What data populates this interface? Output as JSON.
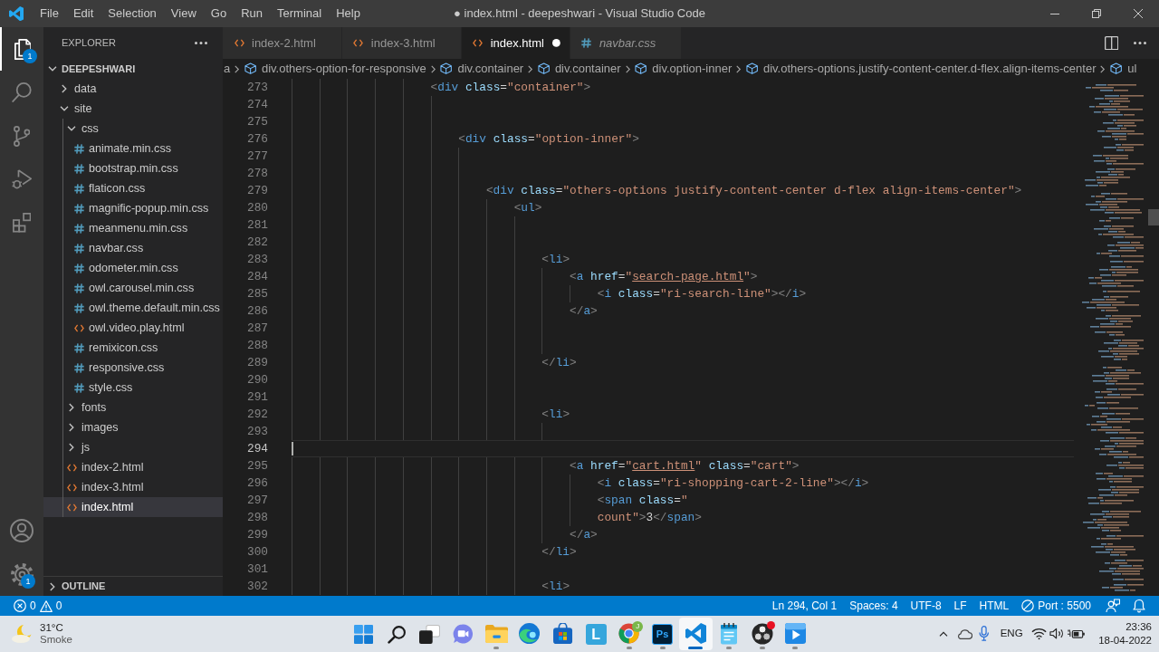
{
  "title_bar": {
    "menus": [
      "File",
      "Edit",
      "Selection",
      "View",
      "Go",
      "Run",
      "Terminal",
      "Help"
    ],
    "title": "● index.html - deepeshwari - Visual Studio Code"
  },
  "activity_bar": {
    "items": [
      {
        "kind": "explorer",
        "selected": true,
        "badge": "1"
      },
      {
        "kind": "search",
        "selected": false
      },
      {
        "kind": "source-control",
        "selected": false
      },
      {
        "kind": "run",
        "selected": false
      },
      {
        "kind": "extensions",
        "selected": false
      }
    ],
    "bottom": [
      {
        "kind": "account",
        "selected": false
      },
      {
        "kind": "settings",
        "selected": false,
        "badge": "1"
      }
    ]
  },
  "sidebar": {
    "title": "EXPLORER",
    "folder": {
      "name": "DEEPESHWARI",
      "expanded": true
    },
    "tree": [
      {
        "name": "data",
        "kind": "folder",
        "expanded": false,
        "selected": false
      },
      {
        "name": "site",
        "kind": "folder",
        "expanded": true,
        "selected": false,
        "children": [
          {
            "name": "css",
            "kind": "folder",
            "expanded": true,
            "selected": false,
            "children": [
              {
                "name": "animate.min.css",
                "kind": "css",
                "selected": false
              },
              {
                "name": "bootstrap.min.css",
                "kind": "css",
                "selected": false
              },
              {
                "name": "flaticon.css",
                "kind": "css",
                "selected": false
              },
              {
                "name": "magnific-popup.min.css",
                "kind": "css",
                "selected": false
              },
              {
                "name": "meanmenu.min.css",
                "kind": "css",
                "selected": false
              },
              {
                "name": "navbar.css",
                "kind": "css",
                "selected": false
              },
              {
                "name": "odometer.min.css",
                "kind": "css",
                "selected": false
              },
              {
                "name": "owl.carousel.min.css",
                "kind": "css",
                "selected": false
              },
              {
                "name": "owl.theme.default.min.css",
                "kind": "css",
                "selected": false
              },
              {
                "name": "owl.video.play.html",
                "kind": "html",
                "selected": false
              },
              {
                "name": "remixicon.css",
                "kind": "css",
                "selected": false
              },
              {
                "name": "responsive.css",
                "kind": "css",
                "selected": false
              },
              {
                "name": "style.css",
                "kind": "css",
                "selected": false
              }
            ]
          },
          {
            "name": "fonts",
            "kind": "folder",
            "expanded": false,
            "selected": false
          },
          {
            "name": "images",
            "kind": "folder",
            "expanded": false,
            "selected": false
          },
          {
            "name": "js",
            "kind": "folder",
            "expanded": false,
            "selected": false
          },
          {
            "name": "index-2.html",
            "kind": "html",
            "selected": false
          },
          {
            "name": "index-3.html",
            "kind": "html",
            "selected": false
          },
          {
            "name": "index.html",
            "kind": "html",
            "selected": true
          }
        ]
      }
    ],
    "outline": {
      "title": "OUTLINE",
      "expanded": false
    }
  },
  "editor": {
    "tabs": [
      {
        "label": "index-2.html",
        "kind": "html",
        "selected": false,
        "modified": false,
        "preview": false
      },
      {
        "label": "index-3.html",
        "kind": "html",
        "selected": false,
        "modified": false,
        "preview": false
      },
      {
        "label": "index.html",
        "kind": "html",
        "selected": true,
        "modified": true,
        "preview": false
      },
      {
        "label": "navbar.css",
        "kind": "css",
        "selected": false,
        "modified": false,
        "preview": true
      }
    ],
    "breadcrumb": [
      {
        "label": "a",
        "kind": "text"
      },
      {
        "label": "div.others-option-for-responsive",
        "kind": "element"
      },
      {
        "label": "div.container",
        "kind": "element"
      },
      {
        "label": "div.container",
        "kind": "element"
      },
      {
        "label": "div.option-inner",
        "kind": "element"
      },
      {
        "label": "div.others-options.justify-content-center.d-flex.align-items-center",
        "kind": "element"
      },
      {
        "label": "ul",
        "kind": "element"
      }
    ],
    "lines": [
      {
        "number": "273",
        "current": false,
        "tokens": [
          {
            "kind": "punct",
            "text": "<"
          },
          {
            "kind": "tag",
            "text": "div"
          },
          {
            "kind": "attr",
            "text": " class"
          },
          {
            "kind": "op",
            "text": "="
          },
          {
            "kind": "string",
            "text": "\"container\""
          },
          {
            "kind": "punct",
            "text": ">"
          }
        ],
        "children": [
          {
            "number": "274",
            "current": false
          },
          {
            "number": "275",
            "current": false
          },
          {
            "number": "276",
            "current": false,
            "tokens": [
              {
                "kind": "punct",
                "text": "<"
              },
              {
                "kind": "tag",
                "text": "div"
              },
              {
                "kind": "attr",
                "text": " class"
              },
              {
                "kind": "op",
                "text": "="
              },
              {
                "kind": "string",
                "text": "\"option-inner\""
              },
              {
                "kind": "punct",
                "text": ">"
              }
            ],
            "children": [
              {
                "number": "277",
                "current": false
              },
              {
                "number": "278",
                "current": false
              },
              {
                "number": "279",
                "current": false,
                "tokens": [
                  {
                    "kind": "punct",
                    "text": "<"
                  },
                  {
                    "kind": "tag",
                    "text": "div"
                  },
                  {
                    "kind": "attr",
                    "text": " class"
                  },
                  {
                    "kind": "op",
                    "text": "="
                  },
                  {
                    "kind": "string",
                    "text": "\"others-options justify-content-center d-flex align-items-center\""
                  },
                  {
                    "kind": "punct",
                    "text": ">"
                  }
                ],
                "children": [
                  {
                    "number": "280",
                    "current": false,
                    "tokens": [
                      {
                        "kind": "punct",
                        "text": "<"
                      },
                      {
                        "kind": "tag",
                        "text": "ul"
                      },
                      {
                        "kind": "punct",
                        "text": ">"
                      }
                    ],
                    "children": [
                      {
                        "number": "281",
                        "current": false
                      },
                      {
                        "number": "282",
                        "current": false
                      },
                      {
                        "number": "283",
                        "current": false,
                        "tokens": [
                          {
                            "kind": "punct",
                            "text": "<"
                          },
                          {
                            "kind": "tag",
                            "text": "li"
                          },
                          {
                            "kind": "punct",
                            "text": ">"
                          }
                        ],
                        "children": [
                          {
                            "number": "284",
                            "current": false,
                            "tokens": [
                              {
                                "kind": "punct",
                                "text": "<"
                              },
                              {
                                "kind": "tag",
                                "text": "a"
                              },
                              {
                                "kind": "attr",
                                "text": " href"
                              },
                              {
                                "kind": "op",
                                "text": "="
                              },
                              {
                                "kind": "string",
                                "text": "\""
                              },
                              {
                                "kind": "link",
                                "text": "search-page.html"
                              },
                              {
                                "kind": "string",
                                "text": "\""
                              },
                              {
                                "kind": "punct",
                                "text": ">"
                              }
                            ],
                            "children": [
                              {
                                "number": "285",
                                "current": false,
                                "tokens": [
                                  {
                                    "kind": "punct",
                                    "text": "<"
                                  },
                                  {
                                    "kind": "tag",
                                    "text": "i"
                                  },
                                  {
                                    "kind": "attr",
                                    "text": " class"
                                  },
                                  {
                                    "kind": "op",
                                    "text": "="
                                  },
                                  {
                                    "kind": "string",
                                    "text": "\"ri-search-line\""
                                  },
                                  {
                                    "kind": "punct",
                                    "text": "></"
                                  },
                                  {
                                    "kind": "tag",
                                    "text": "i"
                                  },
                                  {
                                    "kind": "punct",
                                    "text": ">"
                                  }
                                ]
                              }
                            ]
                          },
                          {
                            "number": "286",
                            "current": false,
                            "tokens": [
                              {
                                "kind": "punct",
                                "text": "</"
                              },
                              {
                                "kind": "tag",
                                "text": "a"
                              },
                              {
                                "kind": "punct",
                                "text": ">"
                              }
                            ]
                          },
                          {
                            "number": "287",
                            "current": false
                          },
                          {
                            "number": "288",
                            "current": false
                          }
                        ]
                      },
                      {
                        "number": "289",
                        "current": false,
                        "tokens": [
                          {
                            "kind": "punct",
                            "text": "</"
                          },
                          {
                            "kind": "tag",
                            "text": "li"
                          },
                          {
                            "kind": "punct",
                            "text": ">"
                          }
                        ]
                      },
                      {
                        "number": "290",
                        "current": false
                      },
                      {
                        "number": "291",
                        "current": false
                      },
                      {
                        "number": "292",
                        "current": false,
                        "tokens": [
                          {
                            "kind": "punct",
                            "text": "<"
                          },
                          {
                            "kind": "tag",
                            "text": "li"
                          },
                          {
                            "kind": "punct",
                            "text": ">"
                          }
                        ],
                        "children": [
                          {
                            "number": "293",
                            "current": false
                          },
                          {
                            "number": "294",
                            "current": true
                          },
                          {
                            "number": "295",
                            "current": false,
                            "tokens": [
                              {
                                "kind": "punct",
                                "text": "<"
                              },
                              {
                                "kind": "tag",
                                "text": "a"
                              },
                              {
                                "kind": "attr",
                                "text": " href"
                              },
                              {
                                "kind": "op",
                                "text": "="
                              },
                              {
                                "kind": "string",
                                "text": "\""
                              },
                              {
                                "kind": "link",
                                "text": "cart.html"
                              },
                              {
                                "kind": "string",
                                "text": "\""
                              },
                              {
                                "kind": "attr",
                                "text": " class"
                              },
                              {
                                "kind": "op",
                                "text": "="
                              },
                              {
                                "kind": "string",
                                "text": "\"cart\""
                              },
                              {
                                "kind": "punct",
                                "text": ">"
                              }
                            ],
                            "children": [
                              {
                                "number": "296",
                                "current": false,
                                "tokens": [
                                  {
                                    "kind": "punct",
                                    "text": "<"
                                  },
                                  {
                                    "kind": "tag",
                                    "text": "i"
                                  },
                                  {
                                    "kind": "attr",
                                    "text": " class"
                                  },
                                  {
                                    "kind": "op",
                                    "text": "="
                                  },
                                  {
                                    "kind": "string",
                                    "text": "\"ri-shopping-cart-2-line\""
                                  },
                                  {
                                    "kind": "punct",
                                    "text": "></"
                                  },
                                  {
                                    "kind": "tag",
                                    "text": "i"
                                  },
                                  {
                                    "kind": "punct",
                                    "text": ">"
                                  }
                                ]
                              },
                              {
                                "number": "297",
                                "current": false,
                                "tokens": [
                                  {
                                    "kind": "punct",
                                    "text": "<"
                                  },
                                  {
                                    "kind": "tag",
                                    "text": "span"
                                  },
                                  {
                                    "kind": "attr",
                                    "text": " class"
                                  },
                                  {
                                    "kind": "op",
                                    "text": "="
                                  },
                                  {
                                    "kind": "string",
                                    "text": "\""
                                  }
                                ]
                              },
                              {
                                "number": "298",
                                "current": false,
                                "tokens": [
                                  {
                                    "kind": "string",
                                    "text": "count\""
                                  },
                                  {
                                    "kind": "punct",
                                    "text": ">"
                                  },
                                  {
                                    "kind": "text",
                                    "text": "3"
                                  },
                                  {
                                    "kind": "punct",
                                    "text": "</"
                                  },
                                  {
                                    "kind": "tag",
                                    "text": "span"
                                  },
                                  {
                                    "kind": "punct",
                                    "text": ">"
                                  }
                                ]
                              }
                            ]
                          },
                          {
                            "number": "299",
                            "current": false,
                            "tokens": [
                              {
                                "kind": "punct",
                                "text": "</"
                              },
                              {
                                "kind": "tag",
                                "text": "a"
                              },
                              {
                                "kind": "punct",
                                "text": ">"
                              }
                            ]
                          }
                        ]
                      },
                      {
                        "number": "300",
                        "current": false,
                        "tokens": [
                          {
                            "kind": "punct",
                            "text": "</"
                          },
                          {
                            "kind": "tag",
                            "text": "li"
                          },
                          {
                            "kind": "punct",
                            "text": ">"
                          }
                        ]
                      },
                      {
                        "number": "301",
                        "current": false
                      },
                      {
                        "number": "302",
                        "current": false,
                        "tokens": [
                          {
                            "kind": "punct",
                            "text": "<"
                          },
                          {
                            "kind": "tag",
                            "text": "li"
                          },
                          {
                            "kind": "punct",
                            "text": ">"
                          }
                        ]
                      }
                    ]
                  }
                ]
              }
            ]
          }
        ]
      }
    ]
  },
  "status_bar": {
    "problems": {
      "errors": "0",
      "warnings": "0"
    },
    "items": [
      "Ln 294, Col 1",
      "Spaces: 4",
      "UTF-8",
      "LF",
      "HTML"
    ],
    "port": "Port : 5500"
  },
  "taskbar": {
    "weather": {
      "temperature": "31°C",
      "condition": "Smoke"
    },
    "apps": [
      {
        "kind": "start",
        "running": false,
        "selected": false,
        "alert": false
      },
      {
        "kind": "search",
        "running": false,
        "selected": false,
        "alert": false
      },
      {
        "kind": "taskview",
        "running": false,
        "selected": false,
        "alert": false
      },
      {
        "kind": "chat",
        "running": false,
        "selected": false,
        "alert": false
      },
      {
        "kind": "folder",
        "running": true,
        "selected": false,
        "alert": false
      },
      {
        "kind": "edge",
        "running": false,
        "selected": false,
        "alert": false
      },
      {
        "kind": "store",
        "running": false,
        "selected": false,
        "alert": false
      },
      {
        "kind": "letter",
        "label": "L",
        "running": false,
        "selected": false,
        "alert": false
      },
      {
        "kind": "chrome",
        "badge": "J",
        "running": true,
        "selected": false,
        "alert": false
      },
      {
        "kind": "ps",
        "label": "Ps",
        "running": true,
        "selected": false,
        "alert": false
      },
      {
        "kind": "code",
        "running": true,
        "selected": true,
        "alert": false
      },
      {
        "kind": "notepad",
        "running": true,
        "selected": false,
        "alert": false
      },
      {
        "kind": "obs",
        "running": true,
        "selected": false,
        "alert": true
      },
      {
        "kind": "player",
        "running": true,
        "selected": false,
        "alert": false
      }
    ],
    "language": "ENG",
    "time": "23:36",
    "date": "18-04-2022"
  }
}
